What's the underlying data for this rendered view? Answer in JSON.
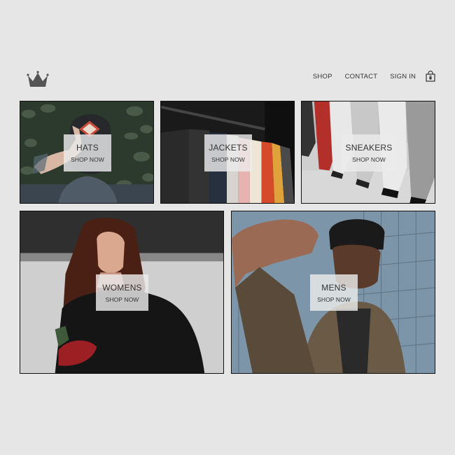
{
  "header": {
    "logo_icon": "crown-icon",
    "nav": {
      "shop": "SHOP",
      "contact": "CONTACT",
      "sign_in": "SIGN IN"
    },
    "cart_icon": "shopping-bag-lock-icon"
  },
  "categories": [
    {
      "title": "HATS",
      "cta": "SHOP NOW"
    },
    {
      "title": "JACKETS",
      "cta": "SHOP NOW"
    },
    {
      "title": "SNEAKERS",
      "cta": "SHOP NOW"
    },
    {
      "title": "WOMENS",
      "cta": "SHOP NOW"
    },
    {
      "title": "MENS",
      "cta": "SHOP NOW"
    }
  ]
}
